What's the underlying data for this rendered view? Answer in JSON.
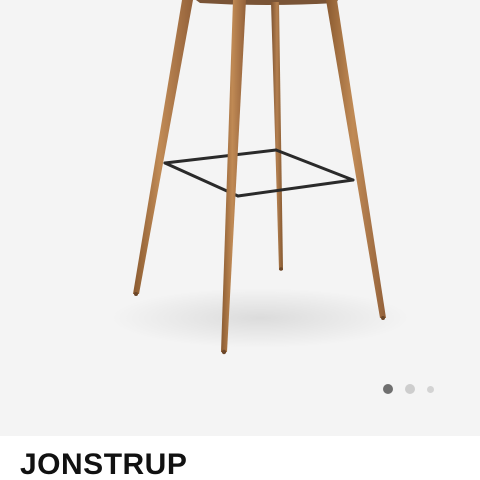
{
  "product": {
    "name": "JONSTRUP"
  },
  "gallery": {
    "image_subject": "bar-stool-icon",
    "dots": [
      {
        "state": "active"
      },
      {
        "state": "inactive"
      },
      {
        "state": "inactive"
      }
    ]
  },
  "colors": {
    "background": "#f4f4f4",
    "leg_wood": "#b07a48",
    "footrest": "#2a2a2a",
    "dot_active": "#6f6f6f",
    "dot_inactive": "#cdcdcd"
  }
}
